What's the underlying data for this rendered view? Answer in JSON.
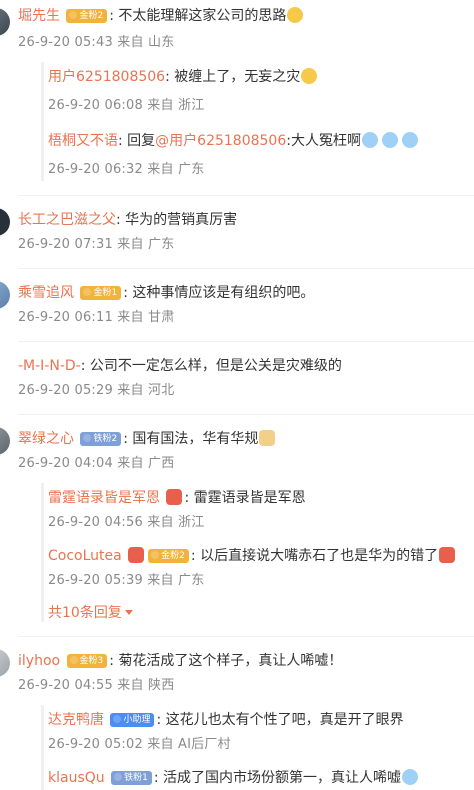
{
  "comments": [
    {
      "name": "堀先生",
      "badge": "金粉2",
      "text": "不太能理解这家公司的思路",
      "meta": "26-9-20 05:43 来自 山东",
      "replies": [
        {
          "name": "用户6251808506",
          "text": "被缠上了，无妄之灾",
          "meta": "26-9-20 06:08 来自 浙江"
        },
        {
          "name": "梧桐又不语",
          "text_prefix": "回复",
          "mention": "@用户6251808506",
          "text": ":大人冤枉啊",
          "meta": "26-9-20 06:32 来自 广东"
        }
      ]
    },
    {
      "name": "长工之巴滋之父",
      "text": "华为的营销真厉害",
      "meta": "26-9-20 07:31 来自 广东"
    },
    {
      "name": "乘雪追风",
      "badge": "金粉1",
      "text": "这种事情应该是有组织的吧。",
      "meta": "26-9-20 06:11 来自 甘肃"
    },
    {
      "name": "-M-I-N-D-",
      "text": "公司不一定怎么样，但是公关是灾难级的",
      "meta": "26-9-20 05:29 来自 河北"
    },
    {
      "name": "翠绿之心",
      "badge": "铁粉2",
      "text": "国有国法，华有华规",
      "meta": "26-9-20 04:04 来自 广西",
      "replies": [
        {
          "name": "雷霆语录皆是军恩",
          "text": "雷霆语录皆是军恩",
          "meta": "26-9-20 04:56 来自 浙江"
        },
        {
          "name": "CocoLutea",
          "badge": "金粉2",
          "text": "以后直接说大嘴赤石了也是华为的错了",
          "meta": "26-9-20 05:39 来自 广东"
        }
      ],
      "more": "共10条回复"
    },
    {
      "name": "ilyhoo",
      "badge": "金粉3",
      "text": "菊花活成了这个样子，真让人唏嘘！",
      "meta": "26-9-20 04:55 来自 陕西",
      "replies": [
        {
          "name": "达克鸭唐",
          "badge": "小助理",
          "text": "这花儿也太有个性了吧，真是开了眼界",
          "meta": "26-9-20 05:02 来自 AI后厂村"
        },
        {
          "name": "klausQu",
          "badge": "铁粉1",
          "text": "活成了国内市场份额第一，真让人唏嘘",
          "meta": ""
        }
      ]
    }
  ]
}
